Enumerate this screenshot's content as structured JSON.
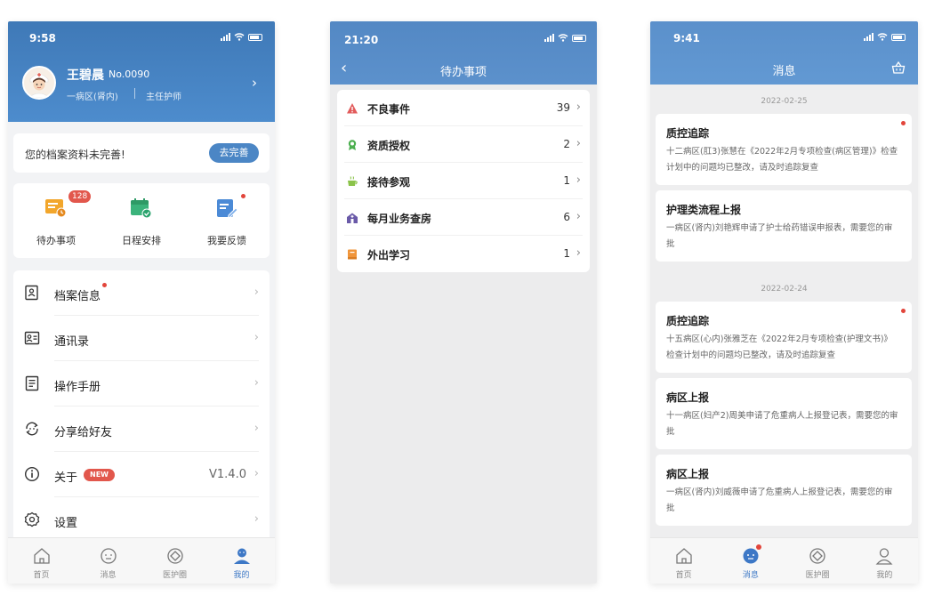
{
  "profile_screen": {
    "status_time": "9:58",
    "user": {
      "name": "王碧晨",
      "staff_no": "No.0090",
      "department": "一病区(肾内)",
      "title": "主任护师"
    },
    "notice": {
      "text": "您的档案资料未完善!",
      "button": "去完善"
    },
    "quick_actions": [
      {
        "label": "待办事项",
        "badge": "128",
        "icon": "todo-icon",
        "color": "#f2a62b"
      },
      {
        "label": "日程安排",
        "icon": "calendar-icon",
        "color": "#3bb37b"
      },
      {
        "label": "我要反馈",
        "icon": "feedback-icon",
        "color": "#4b8ad6"
      }
    ],
    "menu": [
      {
        "label": "档案信息",
        "icon": "profile-file-icon",
        "dot": true
      },
      {
        "label": "通讯录",
        "icon": "contacts-icon"
      },
      {
        "label": "操作手册",
        "icon": "manual-icon"
      },
      {
        "label": "分享给好友",
        "icon": "share-icon"
      },
      {
        "label": "关于",
        "icon": "info-icon",
        "badge": "NEW",
        "value": "V1.4.0"
      },
      {
        "label": "设置",
        "icon": "settings-icon"
      }
    ],
    "tabbar": [
      {
        "label": "首页",
        "icon": "home-icon"
      },
      {
        "label": "消息",
        "icon": "message-icon"
      },
      {
        "label": "医护圈",
        "icon": "circle-icon"
      },
      {
        "label": "我的",
        "icon": "user-icon",
        "active": true
      }
    ]
  },
  "todo_screen": {
    "status_time": "21:20",
    "title": "待办事项",
    "items": [
      {
        "label": "不良事件",
        "count": "39",
        "icon": "warning-icon",
        "color": "#e25b5b"
      },
      {
        "label": "资质授权",
        "count": "2",
        "icon": "authorization-icon",
        "color": "#4caf50"
      },
      {
        "label": "接待参观",
        "count": "1",
        "icon": "reception-icon",
        "color": "#8bc34a"
      },
      {
        "label": "每月业务查房",
        "count": "6",
        "icon": "ward-round-icon",
        "color": "#6a5aa8"
      },
      {
        "label": "外出学习",
        "count": "1",
        "icon": "study-icon",
        "color": "#f0953a"
      }
    ]
  },
  "message_screen": {
    "status_time": "9:41",
    "title": "消息",
    "groups": [
      {
        "date": "2022-02-25",
        "messages": [
          {
            "title": "质控追踪",
            "body": "十二病区(肛3)张慧在《2022年2月专项检查(病区管理)》检查计划中的问题均已整改，请及时追踪复查",
            "unread": true
          },
          {
            "title": "护理类流程上报",
            "body": "一病区(肾内)刘艳辉申请了护士给药错误申报表，需要您的审批",
            "unread": false
          }
        ]
      },
      {
        "date": "2022-02-24",
        "messages": [
          {
            "title": "质控追踪",
            "body": "十五病区(心内)张雅芝在《2022年2月专项检查(护理文书)》检查计划中的问题均已整改，请及时追踪复查",
            "unread": true
          },
          {
            "title": "病区上报",
            "body": "十一病区(妇产2)周美申请了危重病人上报登记表，需要您的审批",
            "unread": false
          },
          {
            "title": "病区上报",
            "body": "一病区(肾内)刘威薇申请了危重病人上报登记表，需要您的审批",
            "unread": false
          }
        ]
      }
    ],
    "tabbar": [
      {
        "label": "首页",
        "icon": "home-icon"
      },
      {
        "label": "消息",
        "icon": "message-icon",
        "active": true,
        "dot": true
      },
      {
        "label": "医护圈",
        "icon": "circle-icon"
      },
      {
        "label": "我的",
        "icon": "user-icon"
      }
    ]
  }
}
